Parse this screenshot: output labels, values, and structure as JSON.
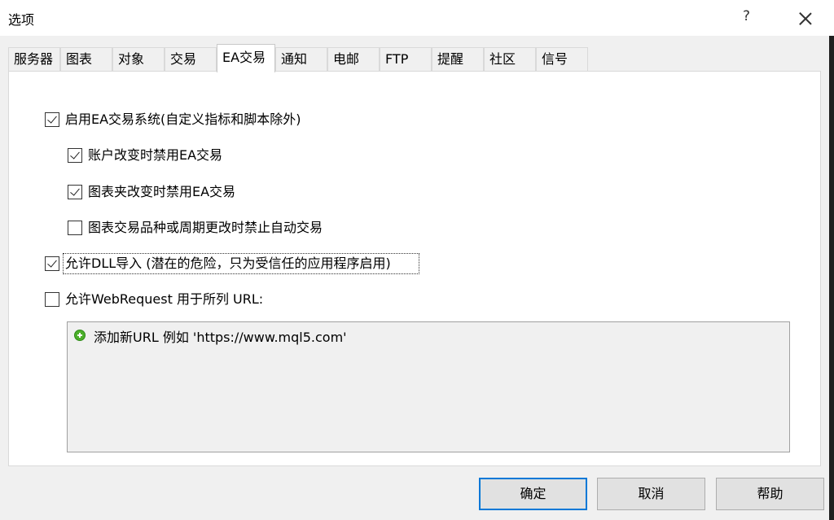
{
  "window": {
    "title": "选项",
    "help_label": "?"
  },
  "tabs": [
    {
      "label": "服务器",
      "active": false
    },
    {
      "label": "图表",
      "active": false
    },
    {
      "label": "对象",
      "active": false
    },
    {
      "label": "交易",
      "active": false
    },
    {
      "label": "EA交易",
      "active": true
    },
    {
      "label": "通知",
      "active": false
    },
    {
      "label": "电邮",
      "active": false
    },
    {
      "label": "FTP",
      "active": false
    },
    {
      "label": "提醒",
      "active": false
    },
    {
      "label": "社区",
      "active": false
    },
    {
      "label": "信号",
      "active": false
    }
  ],
  "options": {
    "enable_ea": {
      "label": "启用EA交易系统(自定义指标和脚本除外)",
      "checked": true
    },
    "disable_on_account_change": {
      "label": "账户改变时禁用EA交易",
      "checked": true
    },
    "disable_on_profile_change": {
      "label": "图表夹改变时禁用EA交易",
      "checked": true
    },
    "disable_on_symbol_change": {
      "label": "图表交易品种或周期更改时禁止自动交易",
      "checked": false
    },
    "allow_dll": {
      "label": "允许DLL导入 (潜在的危险，只为受信任的应用程序启用)",
      "checked": true
    },
    "allow_webrequest": {
      "label": "允许WebRequest 用于所列 URL:",
      "checked": false
    }
  },
  "url_list": {
    "add_item_label": "添加新URL 例如 'https://www.mql5.com'",
    "add_icon": "plus-circle-icon",
    "add_icon_color": "#4caf2a"
  },
  "buttons": {
    "ok": "确定",
    "cancel": "取消",
    "help": "帮助"
  },
  "colors": {
    "focus_accent": "#0078d7",
    "dialog_bg": "#f0f0f0"
  }
}
